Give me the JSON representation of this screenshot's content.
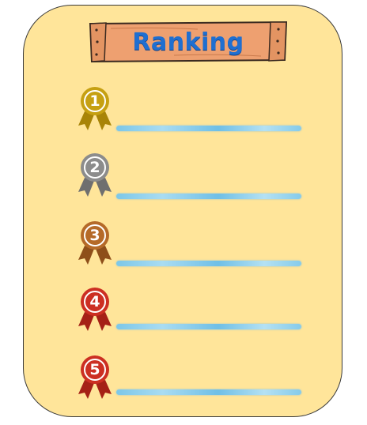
{
  "title": "Ranking",
  "colors": {
    "board": "#ffe59a",
    "sign_wood": "#eea070",
    "title_text": "#1f6fd1",
    "line": "#7cc7e8"
  },
  "ranks": [
    {
      "number": "1",
      "medal_icon": "gold-medal-icon",
      "color": "#c6a012",
      "dark": "#a88408"
    },
    {
      "number": "2",
      "medal_icon": "silver-medal-icon",
      "color": "#8c8c8c",
      "dark": "#6f6f6f"
    },
    {
      "number": "3",
      "medal_icon": "bronze-medal-icon",
      "color": "#b56a28",
      "dark": "#8e4f1a"
    },
    {
      "number": "4",
      "medal_icon": "red-medal-icon",
      "color": "#cc2f22",
      "dark": "#a52116"
    },
    {
      "number": "5",
      "medal_icon": "red-medal-icon",
      "color": "#cc2f22",
      "dark": "#a52116"
    }
  ]
}
